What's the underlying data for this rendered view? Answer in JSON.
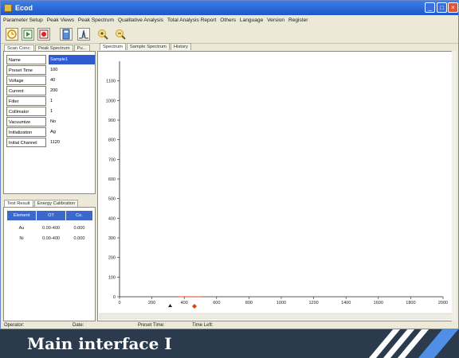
{
  "window": {
    "title": "Ecod"
  },
  "menu": [
    "Parameter Setup",
    "Peak Views",
    "Peak Spectrum",
    "Qualitative Analysis",
    "Total Analysis Report",
    "Others",
    "Language",
    "Version",
    "Register"
  ],
  "left_tabs": [
    "Scan Conc.",
    "Peak Spectrum",
    "Pu..."
  ],
  "properties": [
    {
      "key": "Name",
      "value": "Sample1"
    },
    {
      "key": "Preset Time",
      "value": "100"
    },
    {
      "key": "Voltage",
      "value": "40"
    },
    {
      "key": "Current",
      "value": "200"
    },
    {
      "key": "Filter",
      "value": "1"
    },
    {
      "key": "Collimator",
      "value": "1"
    },
    {
      "key": "Vacuumize",
      "value": "No"
    },
    {
      "key": "Initialization Element",
      "value": "Ag"
    },
    {
      "key": "Initial Channel",
      "value": "1120"
    }
  ],
  "result_tabs": [
    "Test Result",
    "Energy Calibration"
  ],
  "result_table": {
    "headers": [
      "Element",
      "OT",
      "Co."
    ],
    "rows": [
      [
        "Au",
        "0.00-400",
        "0.000"
      ],
      [
        "Ni",
        "0.00-400",
        "0.000"
      ]
    ]
  },
  "chart_tabs": [
    "Spectrum",
    "Sample Spectrum",
    "History"
  ],
  "chart_data": {
    "type": "line",
    "series": [],
    "xlim": [
      0,
      2000
    ],
    "ylim": [
      0,
      1200
    ],
    "x_ticks": [
      "0",
      "200",
      "400",
      "600",
      "800",
      "1000",
      "1200",
      "1400",
      "1600",
      "1800",
      "2000"
    ],
    "y_ticks": [
      "0",
      "100",
      "200",
      "300",
      "400",
      "500",
      "600",
      "700",
      "800",
      "900",
      "1000",
      "1100"
    ]
  },
  "status": {
    "operator": "Operator:",
    "date": "Date:",
    "preset_time": "Preset Time:",
    "time_left": "Time Left:"
  },
  "banner": {
    "text": "Main interface I"
  },
  "colors": {
    "banner_bg": "#2b3a4c",
    "banner_accent": "#4f8fe6",
    "selection": "#2f5bd0",
    "cursor": "#d8431e"
  }
}
